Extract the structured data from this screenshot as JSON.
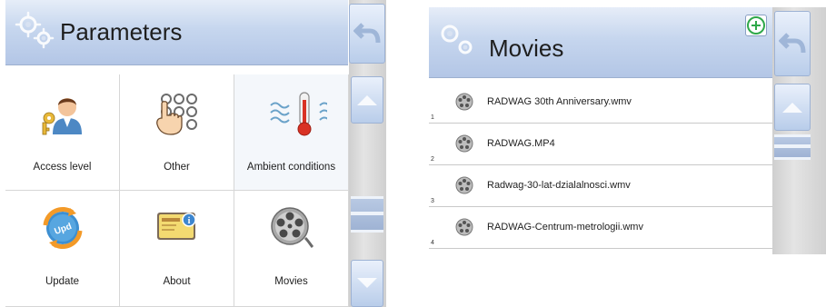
{
  "parameters_screen": {
    "title": "Parameters",
    "tiles": [
      {
        "label": "Access level",
        "icon": "user-keys-icon"
      },
      {
        "label": "Other",
        "icon": "finger-keypad-icon"
      },
      {
        "label": "Ambient conditions",
        "icon": "thermometer-icon"
      },
      {
        "label": "Update",
        "icon": "update-icon"
      },
      {
        "label": "About",
        "icon": "about-card-icon"
      },
      {
        "label": "Movies",
        "icon": "film-reel-icon"
      }
    ]
  },
  "movies_screen": {
    "title": "Movies",
    "items": [
      {
        "num": "1",
        "name": "RADWAG 30th Anniversary.wmv"
      },
      {
        "num": "2",
        "name": "RADWAG.MP4"
      },
      {
        "num": "3",
        "name": "Radwag-30-lat-dzialalnosci.wmv"
      },
      {
        "num": "4",
        "name": "RADWAG-Centrum-metrologii.wmv"
      }
    ]
  },
  "colors": {
    "header": "#c6d6ee",
    "accent_green": "#2fa84a",
    "scroll_grey": "#d6d6d6"
  }
}
